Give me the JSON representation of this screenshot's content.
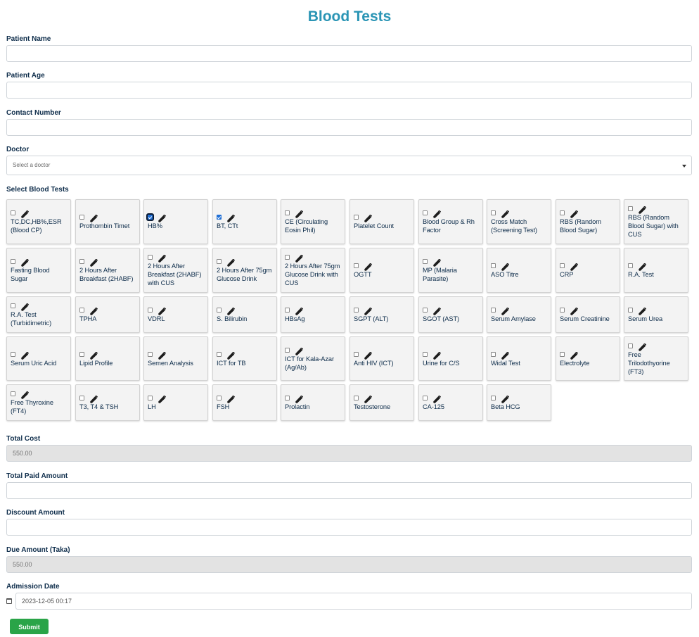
{
  "page": {
    "title": "Blood Tests"
  },
  "form": {
    "patient_name": {
      "label": "Patient Name",
      "value": ""
    },
    "patient_age": {
      "label": "Patient Age",
      "value": ""
    },
    "contact_number": {
      "label": "Contact Number",
      "value": ""
    },
    "doctor": {
      "label": "Doctor",
      "placeholder": "Select a doctor"
    },
    "tests_label": "Select Blood Tests",
    "total_cost": {
      "label": "Total Cost",
      "value": "550.00"
    },
    "total_paid": {
      "label": "Total Paid Amount",
      "value": ""
    },
    "discount": {
      "label": "Discount Amount",
      "value": ""
    },
    "due_amount": {
      "label": "Due Amount (Taka)",
      "value": "550.00"
    },
    "admission_date": {
      "label": "Admission Date",
      "value": "2023-12-05 00:17"
    },
    "submit_label": "Submit"
  },
  "tests": [
    {
      "label": "TC,DC,HB%,ESR (Blood CP)",
      "checked": false
    },
    {
      "label": "Prothombin Timet",
      "checked": false
    },
    {
      "label": "HB%",
      "checked": true,
      "focused": true
    },
    {
      "label": "BT, CTt",
      "checked": true
    },
    {
      "label": "CE (Circulating Eosin Phil)",
      "checked": false
    },
    {
      "label": "Platelet Count",
      "checked": false
    },
    {
      "label": "Blood Group & Rh Factor",
      "checked": false
    },
    {
      "label": "Cross Match (Screening Test)",
      "checked": false
    },
    {
      "label": "RBS (Random Blood Sugar)",
      "checked": false
    },
    {
      "label": "RBS (Random Blood Sugar) with CUS",
      "checked": false
    },
    {
      "label": "Fasting Blood Sugar",
      "checked": false
    },
    {
      "label": "2 Hours After Breakfast (2HABF)",
      "checked": false
    },
    {
      "label": "2 Hours After Breakfast (2HABF) with CUS",
      "checked": false
    },
    {
      "label": "2 Hours After 75gm Glucose Drink",
      "checked": false
    },
    {
      "label": "2 Hours After 75gm Glucose Drink with CUS",
      "checked": false
    },
    {
      "label": "OGTT",
      "checked": false
    },
    {
      "label": "MP (Malaria Parasite)",
      "checked": false
    },
    {
      "label": "ASO Titre",
      "checked": false
    },
    {
      "label": "CRP",
      "checked": false
    },
    {
      "label": "R.A. Test",
      "checked": false
    },
    {
      "label": "R.A. Test (Turbidimetric)",
      "checked": false
    },
    {
      "label": "TPHA",
      "checked": false
    },
    {
      "label": "VDRL",
      "checked": false
    },
    {
      "label": "S. Bilirubin",
      "checked": false
    },
    {
      "label": "HBsAg",
      "checked": false
    },
    {
      "label": "SGPT (ALT)",
      "checked": false
    },
    {
      "label": "SGOT (AST)",
      "checked": false
    },
    {
      "label": "Serum Amylase",
      "checked": false
    },
    {
      "label": "Serum Creatinine",
      "checked": false
    },
    {
      "label": "Serum Urea",
      "checked": false
    },
    {
      "label": "Serum Uric Acid",
      "checked": false
    },
    {
      "label": "Lipid Profile",
      "checked": false
    },
    {
      "label": "Semen Analysis",
      "checked": false
    },
    {
      "label": "ICT for TB",
      "checked": false
    },
    {
      "label": "ICT for Kala-Azar (Ag/Ab)",
      "checked": false
    },
    {
      "label": "Anti HIV (ICT)",
      "checked": false
    },
    {
      "label": "Urine for C/S",
      "checked": false
    },
    {
      "label": "Widal Test",
      "checked": false
    },
    {
      "label": "Electrolyte",
      "checked": false
    },
    {
      "label": "Free Trilodothyorine (FT3)",
      "checked": false
    },
    {
      "label": "Free Thyroxine (FT4)",
      "checked": false
    },
    {
      "label": "T3, T4 & TSH",
      "checked": false
    },
    {
      "label": "LH",
      "checked": false
    },
    {
      "label": "FSH",
      "checked": false
    },
    {
      "label": "Prolactin",
      "checked": false
    },
    {
      "label": "Testosterone",
      "checked": false
    },
    {
      "label": "CA-125",
      "checked": false
    },
    {
      "label": "Beta HCG",
      "checked": false
    }
  ],
  "icons": {
    "test_item": "test-tube-icon",
    "date": "calendar-icon",
    "select": "caret-down-icon"
  },
  "colors": {
    "title": "#2b95b5",
    "submit": "#2aa448",
    "checkbox_checked": "#1f6fd6"
  }
}
